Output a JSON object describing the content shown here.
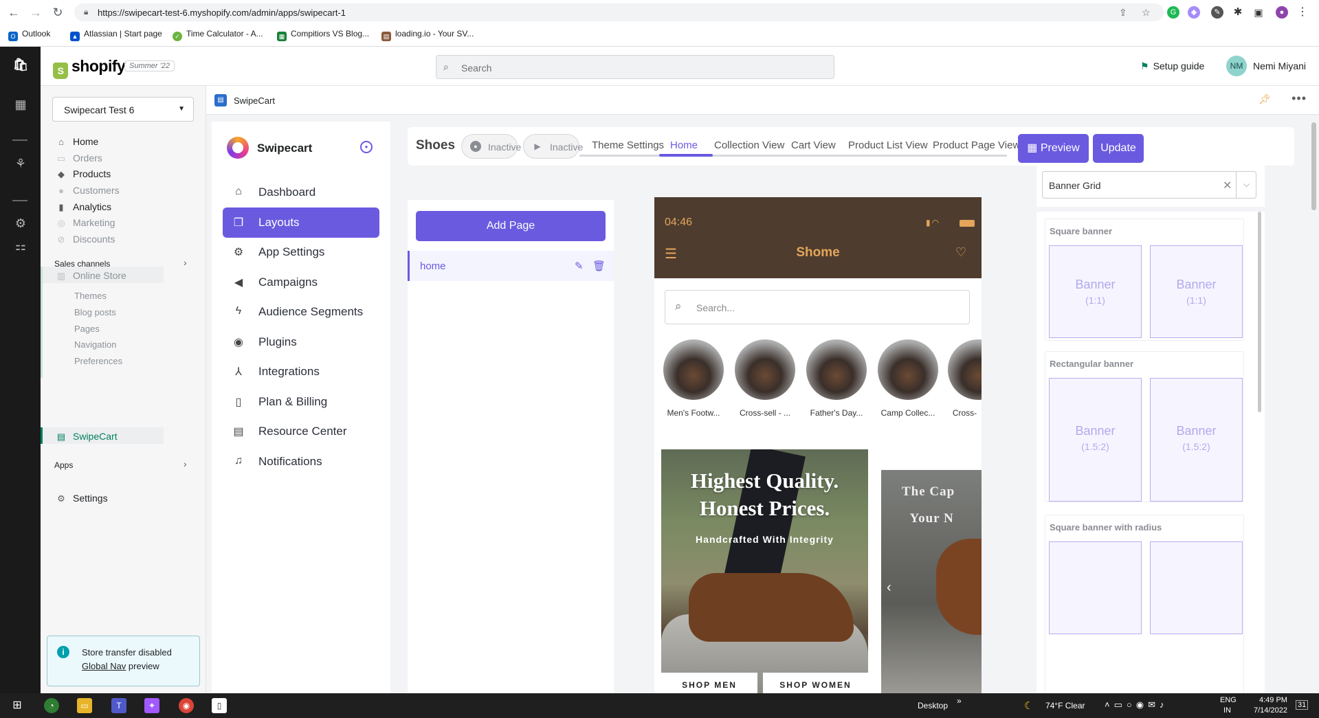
{
  "browser": {
    "url": "https://swipecart-test-6.myshopify.com/admin/apps/swipecart-1",
    "bookmarks": [
      "Outlook",
      "Atlassian | Start page",
      "Time Calculator - A...",
      "Compitiors VS Blog...",
      "loading.io - Your SV..."
    ]
  },
  "shopify": {
    "brand": "shopify",
    "edition": "Summer '22",
    "search_placeholder": "Search",
    "setup_guide": "Setup guide",
    "user_initials": "NM",
    "user_name": "Nemi Miyani",
    "store_name": "Swipecart Test 6",
    "nav": {
      "home": "Home",
      "orders": "Orders",
      "products": "Products",
      "customers": "Customers",
      "analytics": "Analytics",
      "marketing": "Marketing",
      "discounts": "Discounts",
      "sales_channels": "Sales channels",
      "online_store": "Online Store",
      "themes": "Themes",
      "blog_posts": "Blog posts",
      "pages": "Pages",
      "navigation": "Navigation",
      "preferences": "Preferences",
      "swipecart": "SwipeCart",
      "apps": "Apps",
      "settings": "Settings"
    },
    "notice": {
      "line1": "Store transfer disabled",
      "link": "Global Nav",
      "rest": " preview"
    }
  },
  "app": {
    "header_name": "SwipeCart",
    "brand": "Swipecart",
    "sidebar": [
      "Dashboard",
      "Layouts",
      "App Settings",
      "Campaigns",
      "Audience Segments",
      "Plugins",
      "Integrations",
      "Plan & Billing",
      "Resource Center",
      "Notifications"
    ],
    "project_name": "Shoes",
    "ios_status": "Inactive",
    "android_status": "Inactive",
    "tabs": [
      "Theme Settings",
      "Home",
      "Collection View",
      "Cart View",
      "Product List View",
      "Product Page View"
    ],
    "preview_label": "Preview",
    "update_label": "Update",
    "add_page_label": "Add Page",
    "pages": [
      "home"
    ]
  },
  "phone": {
    "time": "04:46",
    "title": "Shome",
    "search_placeholder": "Search...",
    "categories": [
      "Men's Footw...",
      "Cross-sell - ...",
      "Father's Day...",
      "Camp Collec...",
      "Cross-"
    ],
    "banner1": {
      "line1": "Highest Quality.",
      "line2": "Honest Prices.",
      "sub": "Handcrafted With Integrity",
      "btn1": "SHOP MEN",
      "btn2": "SHOP WOMEN"
    },
    "banner2": {
      "line1": "The Cap",
      "line2": "Your N"
    }
  },
  "right_panel": {
    "selected": "Banner Grid",
    "sections": [
      {
        "title": "Square banner",
        "tiles": [
          {
            "label": "Banner",
            "ratio": "(1:1)"
          },
          {
            "label": "Banner",
            "ratio": "(1:1)"
          }
        ]
      },
      {
        "title": "Rectangular banner",
        "tiles": [
          {
            "label": "Banner",
            "ratio": "(1.5:2)"
          },
          {
            "label": "Banner",
            "ratio": "(1.5:2)"
          }
        ]
      },
      {
        "title": "Square banner with radius",
        "tiles": []
      }
    ]
  },
  "taskbar": {
    "desktop": "Desktop",
    "weather": "74°F  Clear",
    "lang1": "ENG",
    "lang2": "IN",
    "time": "4:49 PM",
    "date": "7/14/2022",
    "notif_count": "31"
  }
}
